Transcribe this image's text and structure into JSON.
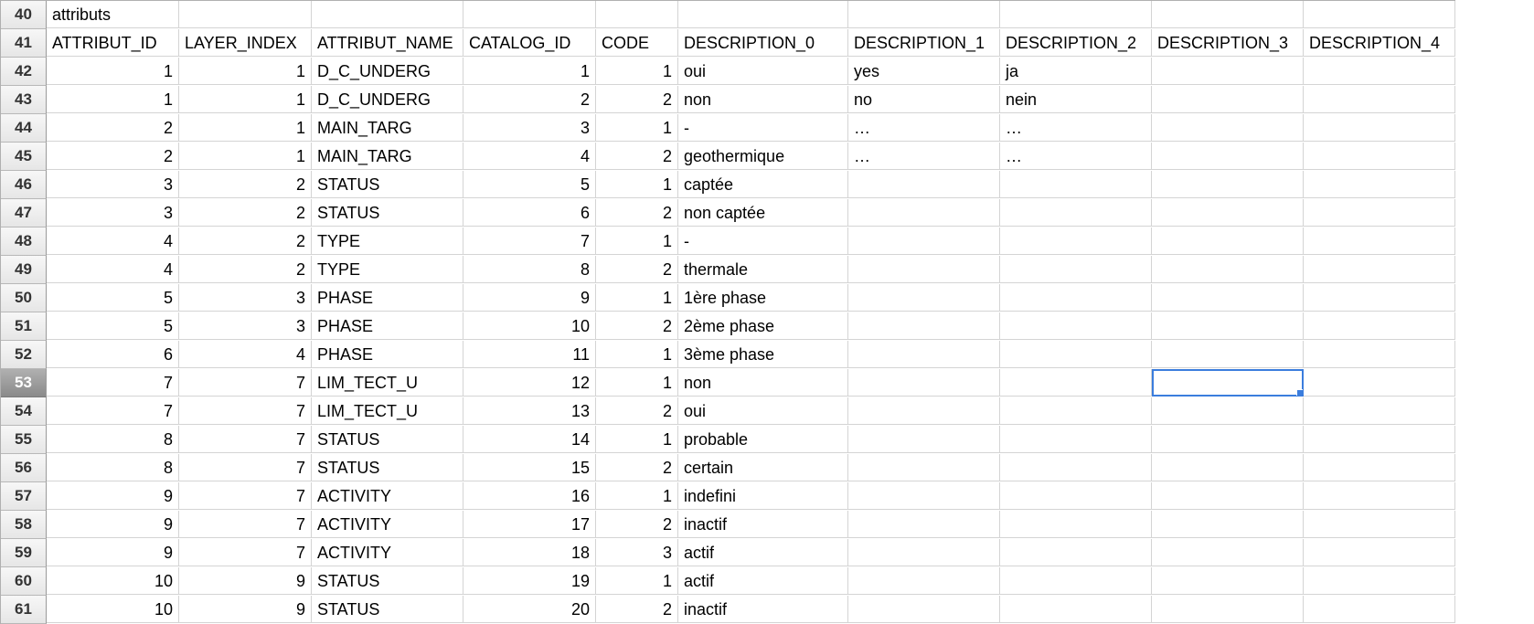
{
  "selected_cell": {
    "row_index": 13,
    "col_index": 8
  },
  "rows": [
    {
      "rownum": "40",
      "cells": [
        {
          "v": "attributs",
          "t": "txt"
        },
        {
          "v": "",
          "t": "txt"
        },
        {
          "v": "",
          "t": "txt"
        },
        {
          "v": "",
          "t": "txt"
        },
        {
          "v": "",
          "t": "txt"
        },
        {
          "v": "",
          "t": "txt"
        },
        {
          "v": "",
          "t": "txt"
        },
        {
          "v": "",
          "t": "txt"
        },
        {
          "v": "",
          "t": "txt"
        },
        {
          "v": "",
          "t": "txt"
        }
      ]
    },
    {
      "rownum": "41",
      "cells": [
        {
          "v": "ATTRIBUT_ID",
          "t": "txt"
        },
        {
          "v": "LAYER_INDEX",
          "t": "txt"
        },
        {
          "v": "ATTRIBUT_NAME",
          "t": "txt"
        },
        {
          "v": "CATALOG_ID",
          "t": "txt"
        },
        {
          "v": "CODE",
          "t": "txt"
        },
        {
          "v": "DESCRIPTION_0",
          "t": "txt"
        },
        {
          "v": "DESCRIPTION_1",
          "t": "txt"
        },
        {
          "v": "DESCRIPTION_2",
          "t": "txt"
        },
        {
          "v": "DESCRIPTION_3",
          "t": "txt"
        },
        {
          "v": "DESCRIPTION_4",
          "t": "txt"
        }
      ]
    },
    {
      "rownum": "42",
      "cells": [
        {
          "v": "1",
          "t": "num"
        },
        {
          "v": "1",
          "t": "num"
        },
        {
          "v": "D_C_UNDERG",
          "t": "txt"
        },
        {
          "v": "1",
          "t": "num"
        },
        {
          "v": "1",
          "t": "num"
        },
        {
          "v": "oui",
          "t": "txt"
        },
        {
          "v": "yes",
          "t": "txt"
        },
        {
          "v": "ja",
          "t": "txt"
        },
        {
          "v": "",
          "t": "txt"
        },
        {
          "v": "",
          "t": "txt"
        }
      ]
    },
    {
      "rownum": "43",
      "cells": [
        {
          "v": "1",
          "t": "num"
        },
        {
          "v": "1",
          "t": "num"
        },
        {
          "v": "D_C_UNDERG",
          "t": "txt"
        },
        {
          "v": "2",
          "t": "num"
        },
        {
          "v": "2",
          "t": "num"
        },
        {
          "v": "non",
          "t": "txt"
        },
        {
          "v": "no",
          "t": "txt"
        },
        {
          "v": "nein",
          "t": "txt"
        },
        {
          "v": "",
          "t": "txt"
        },
        {
          "v": "",
          "t": "txt"
        }
      ]
    },
    {
      "rownum": "44",
      "cells": [
        {
          "v": "2",
          "t": "num"
        },
        {
          "v": "1",
          "t": "num"
        },
        {
          "v": "MAIN_TARG",
          "t": "txt"
        },
        {
          "v": "3",
          "t": "num"
        },
        {
          "v": "1",
          "t": "num"
        },
        {
          "v": "-",
          "t": "txt"
        },
        {
          "v": "…",
          "t": "txt"
        },
        {
          "v": "…",
          "t": "txt"
        },
        {
          "v": "",
          "t": "txt"
        },
        {
          "v": "",
          "t": "txt"
        }
      ]
    },
    {
      "rownum": "45",
      "cells": [
        {
          "v": "2",
          "t": "num"
        },
        {
          "v": "1",
          "t": "num"
        },
        {
          "v": "MAIN_TARG",
          "t": "txt"
        },
        {
          "v": "4",
          "t": "num"
        },
        {
          "v": "2",
          "t": "num"
        },
        {
          "v": "geothermique",
          "t": "txt"
        },
        {
          "v": "…",
          "t": "txt"
        },
        {
          "v": "…",
          "t": "txt"
        },
        {
          "v": "",
          "t": "txt"
        },
        {
          "v": "",
          "t": "txt"
        }
      ]
    },
    {
      "rownum": "46",
      "cells": [
        {
          "v": "3",
          "t": "num"
        },
        {
          "v": "2",
          "t": "num"
        },
        {
          "v": "STATUS",
          "t": "txt"
        },
        {
          "v": "5",
          "t": "num"
        },
        {
          "v": "1",
          "t": "num"
        },
        {
          "v": "captée",
          "t": "txt"
        },
        {
          "v": "",
          "t": "txt"
        },
        {
          "v": "",
          "t": "txt"
        },
        {
          "v": "",
          "t": "txt"
        },
        {
          "v": "",
          "t": "txt"
        }
      ]
    },
    {
      "rownum": "47",
      "cells": [
        {
          "v": "3",
          "t": "num"
        },
        {
          "v": "2",
          "t": "num"
        },
        {
          "v": "STATUS",
          "t": "txt"
        },
        {
          "v": "6",
          "t": "num"
        },
        {
          "v": "2",
          "t": "num"
        },
        {
          "v": "non captée",
          "t": "txt"
        },
        {
          "v": "",
          "t": "txt"
        },
        {
          "v": "",
          "t": "txt"
        },
        {
          "v": "",
          "t": "txt"
        },
        {
          "v": "",
          "t": "txt"
        }
      ]
    },
    {
      "rownum": "48",
      "cells": [
        {
          "v": "4",
          "t": "num"
        },
        {
          "v": "2",
          "t": "num"
        },
        {
          "v": "TYPE",
          "t": "txt"
        },
        {
          "v": "7",
          "t": "num"
        },
        {
          "v": "1",
          "t": "num"
        },
        {
          "v": "-",
          "t": "txt"
        },
        {
          "v": "",
          "t": "txt"
        },
        {
          "v": "",
          "t": "txt"
        },
        {
          "v": "",
          "t": "txt"
        },
        {
          "v": "",
          "t": "txt"
        }
      ]
    },
    {
      "rownum": "49",
      "cells": [
        {
          "v": "4",
          "t": "num"
        },
        {
          "v": "2",
          "t": "num"
        },
        {
          "v": "TYPE",
          "t": "txt"
        },
        {
          "v": "8",
          "t": "num"
        },
        {
          "v": "2",
          "t": "num"
        },
        {
          "v": "thermale",
          "t": "txt"
        },
        {
          "v": "",
          "t": "txt"
        },
        {
          "v": "",
          "t": "txt"
        },
        {
          "v": "",
          "t": "txt"
        },
        {
          "v": "",
          "t": "txt"
        }
      ]
    },
    {
      "rownum": "50",
      "cells": [
        {
          "v": "5",
          "t": "num"
        },
        {
          "v": "3",
          "t": "num"
        },
        {
          "v": "PHASE",
          "t": "txt"
        },
        {
          "v": "9",
          "t": "num"
        },
        {
          "v": "1",
          "t": "num"
        },
        {
          "v": "1ère phase",
          "t": "txt"
        },
        {
          "v": "",
          "t": "txt"
        },
        {
          "v": "",
          "t": "txt"
        },
        {
          "v": "",
          "t": "txt"
        },
        {
          "v": "",
          "t": "txt"
        }
      ]
    },
    {
      "rownum": "51",
      "cells": [
        {
          "v": "5",
          "t": "num"
        },
        {
          "v": "3",
          "t": "num"
        },
        {
          "v": "PHASE",
          "t": "txt"
        },
        {
          "v": "10",
          "t": "num"
        },
        {
          "v": "2",
          "t": "num"
        },
        {
          "v": "2ème phase",
          "t": "txt"
        },
        {
          "v": "",
          "t": "txt"
        },
        {
          "v": "",
          "t": "txt"
        },
        {
          "v": "",
          "t": "txt"
        },
        {
          "v": "",
          "t": "txt"
        }
      ]
    },
    {
      "rownum": "52",
      "cells": [
        {
          "v": "6",
          "t": "num"
        },
        {
          "v": "4",
          "t": "num"
        },
        {
          "v": "PHASE",
          "t": "txt"
        },
        {
          "v": "11",
          "t": "num"
        },
        {
          "v": "1",
          "t": "num"
        },
        {
          "v": "3ème phase",
          "t": "txt"
        },
        {
          "v": "",
          "t": "txt"
        },
        {
          "v": "",
          "t": "txt"
        },
        {
          "v": "",
          "t": "txt"
        },
        {
          "v": "",
          "t": "txt"
        }
      ]
    },
    {
      "rownum": "53",
      "cells": [
        {
          "v": "7",
          "t": "num"
        },
        {
          "v": "7",
          "t": "num"
        },
        {
          "v": "LIM_TECT_U",
          "t": "txt"
        },
        {
          "v": "12",
          "t": "num"
        },
        {
          "v": "1",
          "t": "num"
        },
        {
          "v": "non",
          "t": "txt"
        },
        {
          "v": "",
          "t": "txt"
        },
        {
          "v": "",
          "t": "txt"
        },
        {
          "v": "",
          "t": "txt"
        },
        {
          "v": "",
          "t": "txt"
        }
      ]
    },
    {
      "rownum": "54",
      "cells": [
        {
          "v": "7",
          "t": "num"
        },
        {
          "v": "7",
          "t": "num"
        },
        {
          "v": "LIM_TECT_U",
          "t": "txt"
        },
        {
          "v": "13",
          "t": "num"
        },
        {
          "v": "2",
          "t": "num"
        },
        {
          "v": "oui",
          "t": "txt"
        },
        {
          "v": "",
          "t": "txt"
        },
        {
          "v": "",
          "t": "txt"
        },
        {
          "v": "",
          "t": "txt"
        },
        {
          "v": "",
          "t": "txt"
        }
      ]
    },
    {
      "rownum": "55",
      "cells": [
        {
          "v": "8",
          "t": "num"
        },
        {
          "v": "7",
          "t": "num"
        },
        {
          "v": "STATUS",
          "t": "txt"
        },
        {
          "v": "14",
          "t": "num"
        },
        {
          "v": "1",
          "t": "num"
        },
        {
          "v": "probable",
          "t": "txt"
        },
        {
          "v": "",
          "t": "txt"
        },
        {
          "v": "",
          "t": "txt"
        },
        {
          "v": "",
          "t": "txt"
        },
        {
          "v": "",
          "t": "txt"
        }
      ]
    },
    {
      "rownum": "56",
      "cells": [
        {
          "v": "8",
          "t": "num"
        },
        {
          "v": "7",
          "t": "num"
        },
        {
          "v": "STATUS",
          "t": "txt"
        },
        {
          "v": "15",
          "t": "num"
        },
        {
          "v": "2",
          "t": "num"
        },
        {
          "v": "certain",
          "t": "txt"
        },
        {
          "v": "",
          "t": "txt"
        },
        {
          "v": "",
          "t": "txt"
        },
        {
          "v": "",
          "t": "txt"
        },
        {
          "v": "",
          "t": "txt"
        }
      ]
    },
    {
      "rownum": "57",
      "cells": [
        {
          "v": "9",
          "t": "num"
        },
        {
          "v": "7",
          "t": "num"
        },
        {
          "v": "ACTIVITY",
          "t": "txt"
        },
        {
          "v": "16",
          "t": "num"
        },
        {
          "v": "1",
          "t": "num"
        },
        {
          "v": "indefini",
          "t": "txt"
        },
        {
          "v": "",
          "t": "txt"
        },
        {
          "v": "",
          "t": "txt"
        },
        {
          "v": "",
          "t": "txt"
        },
        {
          "v": "",
          "t": "txt"
        }
      ]
    },
    {
      "rownum": "58",
      "cells": [
        {
          "v": "9",
          "t": "num"
        },
        {
          "v": "7",
          "t": "num"
        },
        {
          "v": "ACTIVITY",
          "t": "txt"
        },
        {
          "v": "17",
          "t": "num"
        },
        {
          "v": "2",
          "t": "num"
        },
        {
          "v": "inactif",
          "t": "txt"
        },
        {
          "v": "",
          "t": "txt"
        },
        {
          "v": "",
          "t": "txt"
        },
        {
          "v": "",
          "t": "txt"
        },
        {
          "v": "",
          "t": "txt"
        }
      ]
    },
    {
      "rownum": "59",
      "cells": [
        {
          "v": "9",
          "t": "num"
        },
        {
          "v": "7",
          "t": "num"
        },
        {
          "v": "ACTIVITY",
          "t": "txt"
        },
        {
          "v": "18",
          "t": "num"
        },
        {
          "v": "3",
          "t": "num"
        },
        {
          "v": "actif",
          "t": "txt"
        },
        {
          "v": "",
          "t": "txt"
        },
        {
          "v": "",
          "t": "txt"
        },
        {
          "v": "",
          "t": "txt"
        },
        {
          "v": "",
          "t": "txt"
        }
      ]
    },
    {
      "rownum": "60",
      "cells": [
        {
          "v": "10",
          "t": "num"
        },
        {
          "v": "9",
          "t": "num"
        },
        {
          "v": "STATUS",
          "t": "txt"
        },
        {
          "v": "19",
          "t": "num"
        },
        {
          "v": "1",
          "t": "num"
        },
        {
          "v": "actif",
          "t": "txt"
        },
        {
          "v": "",
          "t": "txt"
        },
        {
          "v": "",
          "t": "txt"
        },
        {
          "v": "",
          "t": "txt"
        },
        {
          "v": "",
          "t": "txt"
        }
      ]
    },
    {
      "rownum": "61",
      "cells": [
        {
          "v": "10",
          "t": "num"
        },
        {
          "v": "9",
          "t": "num"
        },
        {
          "v": "STATUS",
          "t": "txt"
        },
        {
          "v": "20",
          "t": "num"
        },
        {
          "v": "2",
          "t": "num"
        },
        {
          "v": "inactif",
          "t": "txt"
        },
        {
          "v": "",
          "t": "txt"
        },
        {
          "v": "",
          "t": "txt"
        },
        {
          "v": "",
          "t": "txt"
        },
        {
          "v": "",
          "t": "txt"
        }
      ]
    }
  ]
}
